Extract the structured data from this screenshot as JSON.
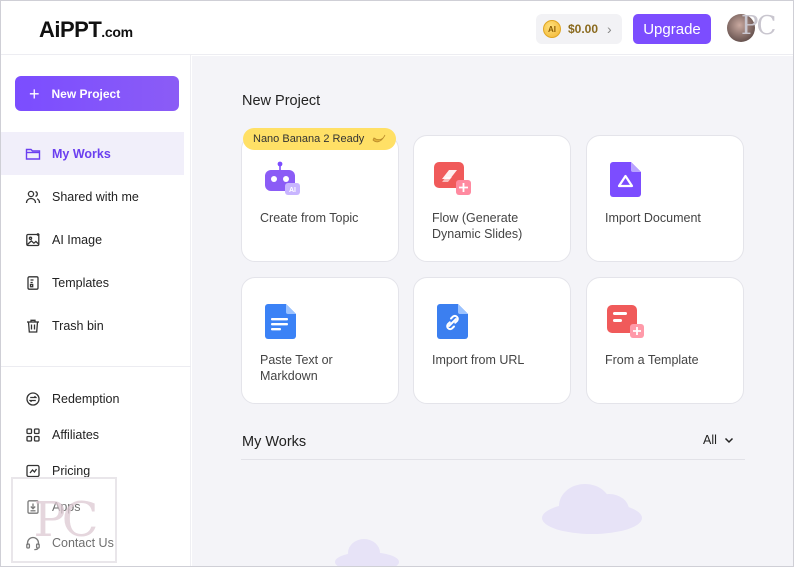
{
  "header": {
    "logo_main": "AiPPT",
    "logo_suffix": ".com",
    "balance": "$0.00",
    "coin_label": "AI",
    "upgrade_label": "Upgrade",
    "watermark": "PC"
  },
  "sidebar": {
    "new_project_label": "New Project",
    "primary_items": [
      {
        "label": "My Works",
        "icon": "folder-icon",
        "active": true
      },
      {
        "label": "Shared with me",
        "icon": "users-icon"
      },
      {
        "label": "AI Image",
        "icon": "image-icon"
      },
      {
        "label": "Templates",
        "icon": "template-icon"
      },
      {
        "label": "Trash bin",
        "icon": "trash-icon"
      }
    ],
    "secondary_items": [
      {
        "label": "Redemption",
        "icon": "redemption-icon"
      },
      {
        "label": "Affiliates",
        "icon": "affiliates-icon"
      },
      {
        "label": "Pricing",
        "icon": "pricing-icon"
      },
      {
        "label": "Apps",
        "icon": "apps-icon"
      },
      {
        "label": "Contact Us",
        "icon": "headset-icon"
      }
    ],
    "watermark": "PC"
  },
  "main": {
    "new_project_title": "New Project",
    "badge_label": "Nano Banana 2 Ready",
    "cards": [
      {
        "label": "Create from Topic",
        "icon": "robot-ai-icon"
      },
      {
        "label": "Flow (Generate Dynamic Slides)",
        "icon": "flow-slides-icon"
      },
      {
        "label": "Import Document",
        "icon": "document-import-icon"
      },
      {
        "label": "Paste Text or Markdown",
        "icon": "text-document-icon"
      },
      {
        "label": "Import from URL",
        "icon": "link-document-icon"
      },
      {
        "label": "From a Template",
        "icon": "template-add-icon"
      }
    ],
    "my_works_title": "My Works",
    "filter_label": "All"
  },
  "colors": {
    "accent": "#7c4dff",
    "badge": "#ffe066",
    "active_nav_bg": "#f1effa",
    "main_bg": "#f4f4f8"
  }
}
